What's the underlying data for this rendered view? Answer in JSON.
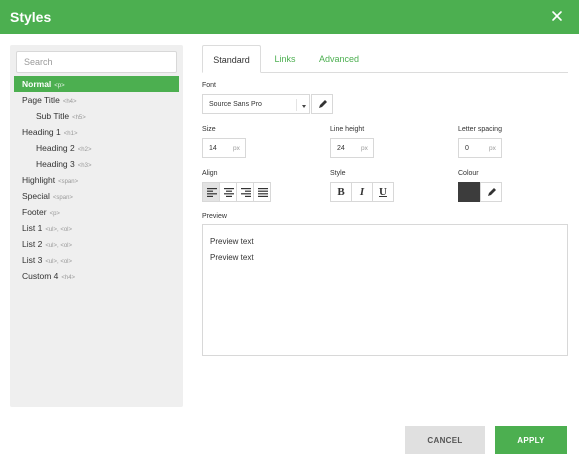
{
  "dialog": {
    "title": "Styles",
    "close_icon": "close-icon"
  },
  "sidebar": {
    "search_placeholder": "Search",
    "items": [
      {
        "label": "Normal",
        "tag": "<p>",
        "selected": true
      },
      {
        "label": "Page Title",
        "tag": "<h4>"
      },
      {
        "label": "Sub Title",
        "tag": "<h5>"
      },
      {
        "label": "Heading 1",
        "tag": "<h1>"
      },
      {
        "label": "Heading 2",
        "tag": "<h2>"
      },
      {
        "label": "Heading 3",
        "tag": "<h3>"
      },
      {
        "label": "Highlight",
        "tag": "<span>"
      },
      {
        "label": "Special",
        "tag": "<span>"
      },
      {
        "label": "Footer",
        "tag": "<p>"
      },
      {
        "label": "List 1",
        "tag": "<ul>, <ol>"
      },
      {
        "label": "List 2",
        "tag": "<ul>, <ol>"
      },
      {
        "label": "List 3",
        "tag": "<ul>, <ol>"
      },
      {
        "label": "Custom 4",
        "tag": "<h4>"
      }
    ]
  },
  "tabs": [
    {
      "label": "Standard",
      "active": true
    },
    {
      "label": "Links"
    },
    {
      "label": "Advanced"
    }
  ],
  "form": {
    "font_label": "Font",
    "font_value": "Source Sans Pro",
    "size_label": "Size",
    "size_value": "14",
    "size_unit": "px",
    "line_height_label": "Line height",
    "line_height_value": "24",
    "line_height_unit": "px",
    "letter_spacing_label": "Letter spacing",
    "letter_spacing_value": "0",
    "letter_spacing_unit": "px",
    "align_label": "Align",
    "align_selected": "left",
    "style_label": "Style",
    "style_bold": "B",
    "style_italic": "I",
    "style_underline": "U",
    "colour_label": "Colour",
    "colour_value": "#3c3c3c",
    "preview_label": "Preview",
    "preview_lines": [
      "Preview text",
      "Preview text"
    ]
  },
  "footer": {
    "cancel_label": "CANCEL",
    "apply_label": "APPLY"
  },
  "colors": {
    "accent": "#4caf50",
    "selected_bg": "#4caf50",
    "cancel_bg": "#e0e0e0"
  }
}
